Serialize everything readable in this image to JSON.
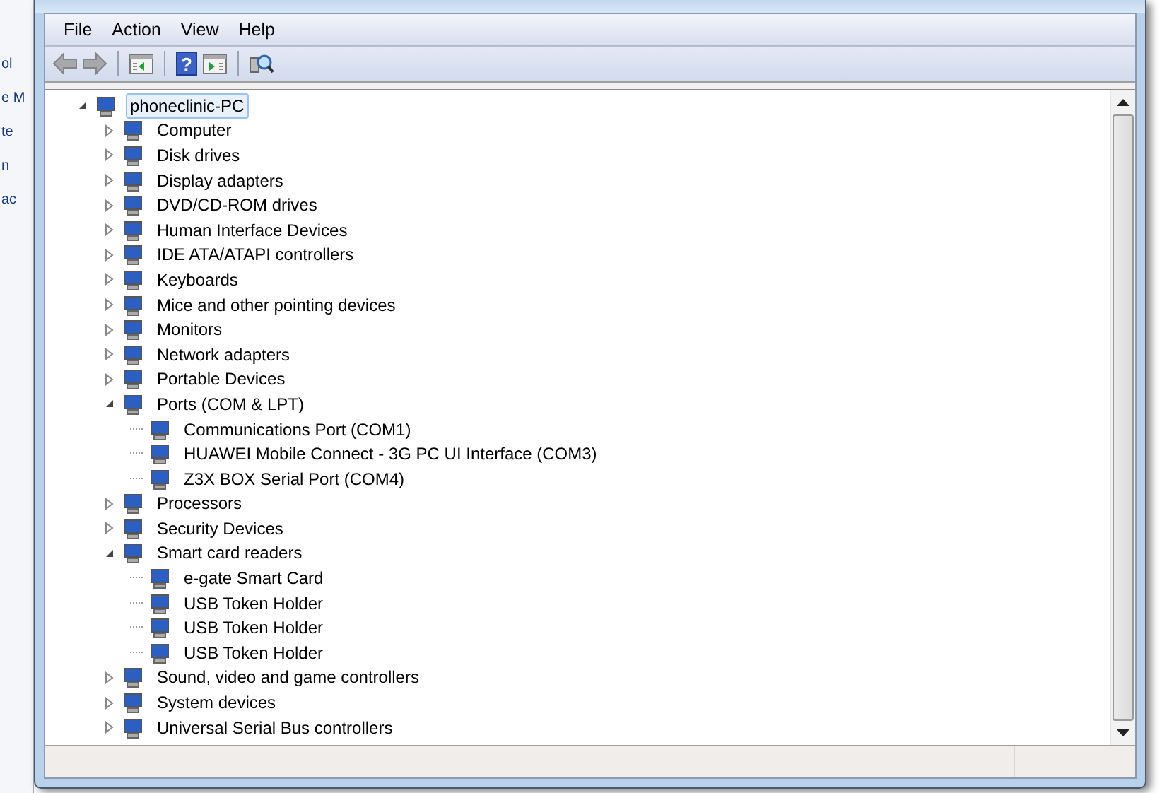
{
  "background_window": {
    "texts": [
      "ol",
      "e M",
      "te",
      "n",
      "ac"
    ]
  },
  "menu_bar": [
    "File",
    "Action",
    "View",
    "Help"
  ],
  "toolbar": [
    {
      "kind": "back",
      "disabled": true
    },
    {
      "kind": "forward",
      "disabled": true
    },
    {
      "kind": "separator"
    },
    {
      "kind": "console"
    },
    {
      "kind": "separator"
    },
    {
      "kind": "help",
      "glyph": "?"
    },
    {
      "kind": "pane"
    },
    {
      "kind": "separator"
    },
    {
      "kind": "scan"
    }
  ],
  "tree": {
    "label": "phoneclinic-PC",
    "selected": true,
    "expanded": true,
    "children": [
      {
        "label": "Computer",
        "expanded": false
      },
      {
        "label": "Disk drives",
        "expanded": false
      },
      {
        "label": "Display adapters",
        "expanded": false
      },
      {
        "label": "DVD/CD-ROM drives",
        "expanded": false
      },
      {
        "label": "Human Interface Devices",
        "expanded": false
      },
      {
        "label": "IDE ATA/ATAPI controllers",
        "expanded": false
      },
      {
        "label": "Keyboards",
        "expanded": false
      },
      {
        "label": "Mice and other pointing devices",
        "expanded": false
      },
      {
        "label": "Monitors",
        "expanded": false
      },
      {
        "label": "Network adapters",
        "expanded": false
      },
      {
        "label": "Portable Devices",
        "expanded": false
      },
      {
        "label": "Ports (COM & LPT)",
        "expanded": true,
        "children": [
          {
            "label": "Communications Port (COM1)"
          },
          {
            "label": "HUAWEI Mobile Connect - 3G PC UI Interface (COM3)"
          },
          {
            "label": "Z3X BOX Serial Port (COM4)"
          }
        ]
      },
      {
        "label": "Processors",
        "expanded": false
      },
      {
        "label": "Security Devices",
        "expanded": false
      },
      {
        "label": "Smart card readers",
        "expanded": true,
        "children": [
          {
            "label": "e-gate Smart Card"
          },
          {
            "label": "USB Token Holder"
          },
          {
            "label": "USB Token Holder"
          },
          {
            "label": "USB Token Holder"
          }
        ]
      },
      {
        "label": "Sound, video and game controllers",
        "expanded": false
      },
      {
        "label": "System devices",
        "expanded": false
      },
      {
        "label": "Universal Serial Bus controllers",
        "expanded": false
      }
    ]
  }
}
